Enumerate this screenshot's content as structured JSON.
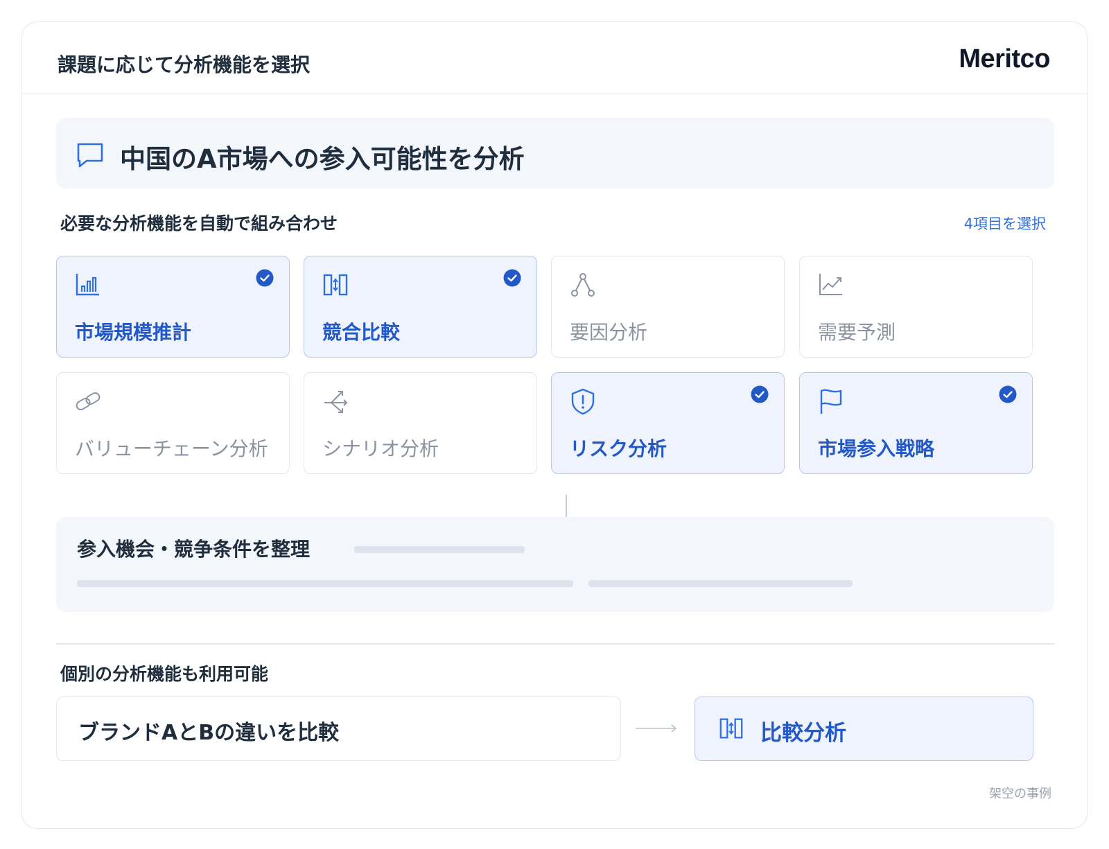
{
  "header": {
    "title": "課題に応じて分析機能を選択",
    "logo": "Meritco"
  },
  "query": {
    "text": "中国のA市場への参入可能性を分析",
    "icon": "chat-bubble-icon"
  },
  "auto_section": {
    "label": "必要な分析機能を自動で組み合わせ",
    "selected_count": "4項目を選択"
  },
  "tiles": [
    {
      "label": "市場規模推計",
      "icon": "bar-chart-icon",
      "selected": true
    },
    {
      "label": "競合比較",
      "icon": "compare-icon",
      "selected": true
    },
    {
      "label": "要因分析",
      "icon": "factor-nodes-icon",
      "selected": false
    },
    {
      "label": "需要予測",
      "icon": "trend-line-icon",
      "selected": false
    },
    {
      "label": "バリューチェーン分析",
      "icon": "link-icon",
      "selected": false
    },
    {
      "label": "シナリオ分析",
      "icon": "branch-arrows-icon",
      "selected": false
    },
    {
      "label": "リスク分析",
      "icon": "shield-alert-icon",
      "selected": true
    },
    {
      "label": "市場参入戦略",
      "icon": "flag-icon",
      "selected": true
    }
  ],
  "result": {
    "title": "参入機会・競争条件を整理"
  },
  "individual_section": {
    "label": "個別の分析機能も利用可能",
    "ask": "ブランドAとBの違いを比較",
    "answer": "比較分析",
    "answer_icon": "compare-icon"
  },
  "footnote": "架空の事例",
  "colors": {
    "accent": "#2f6fe0",
    "selected_text": "#2359c7",
    "selected_bg": "#eef3fd",
    "panel_bg": "#f3f6fb",
    "muted_text": "#8a93a0",
    "border": "#e3e7ee"
  }
}
